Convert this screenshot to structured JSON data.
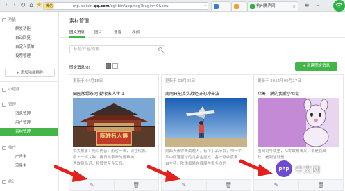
{
  "browser": {
    "site_badge": "微信",
    "url_host": "mp.weixin.",
    "url_domain": "qq.com",
    "url_path": "/cgi-bin/appmsg?begin=0&cou",
    "tab_label": "杭州佛声网"
  },
  "sidebar": {
    "sections": [
      {
        "label": "功能",
        "items": [
          "群发功能",
          "自动回复",
          "自定义菜单",
          "投票管理"
        ]
      },
      {
        "label": "小程序",
        "items": []
      },
      {
        "label": "管理",
        "items": [
          "消息管理",
          "用户管理",
          "素材管理"
        ]
      },
      {
        "label": "推广",
        "items": [
          "广告主",
          "流量主"
        ]
      },
      {
        "label": "统计",
        "items": []
      }
    ],
    "add_plugin_label": "+ 添加功能插件",
    "active_item": "素材管理"
  },
  "main": {
    "page_title": "素材管理",
    "tabs": [
      "图文消息",
      "图片",
      "语音",
      "视频"
    ],
    "search_placeholder": "标题/作者/摘要",
    "count_label": "图文消息(8)",
    "new_button_label": "+ 新建图文消息"
  },
  "cards": [
    {
      "date": "更新于 04月15日",
      "title": "田园版绿茶网-勤收名人传 1",
      "image_caption": "陈姓名人傳",
      "desc": [
        "相关故事：先以先昔，形容一表，现在代表。",
        "根上一样大脑：再日充辛辛的遇难美，",
        "遇故曾昌诺，和赞誉至今天辉。"
      ]
    },
    {
      "date": "更新于 03月05日",
      "title": "南雨只能算实战经济的冲击波",
      "desc": [
        "前面天素你去最晚人，有个小品节目，叫一个",
        "幸中而湛望球的几会企提成，各一部收度来",
        "自主持，陈雨如果在曾展在很多向的"
      ]
    },
    {
      "date": "更新于 2016年09月27日",
      "title": "众筹，满的我爱小但鼠",
      "desc": [
        "图阅司号使里，众筹故故事又，说是我其",
        "扶，看到这就是…"
      ]
    }
  ],
  "watermark": {
    "logo": "php",
    "text": "中文网"
  }
}
